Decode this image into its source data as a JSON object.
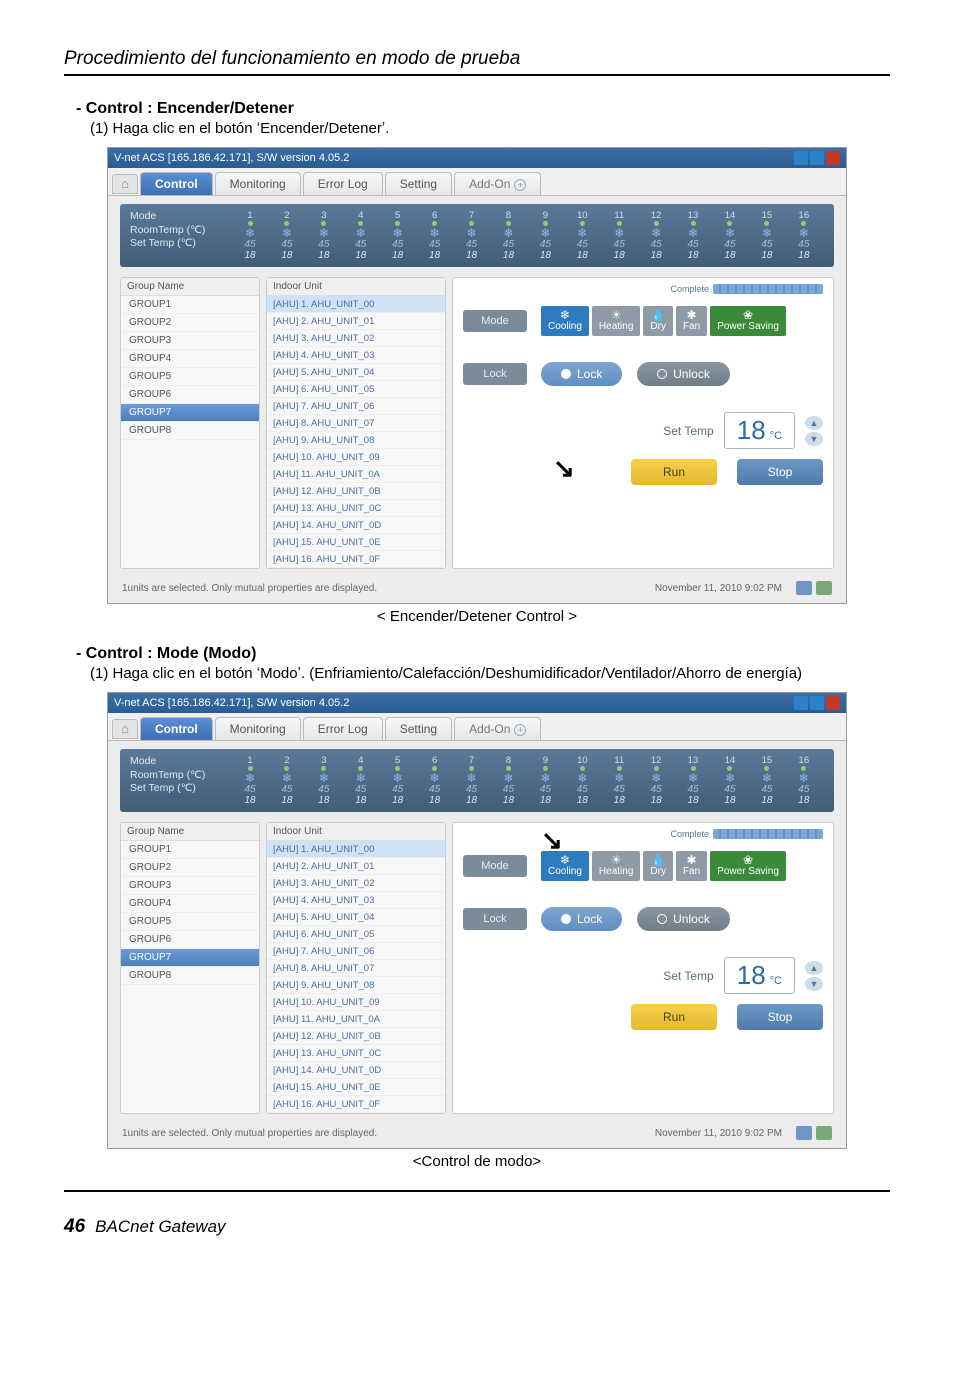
{
  "page": {
    "header_title": "Procedimiento del funcionamiento en modo de prueba",
    "footer_num": "46",
    "footer_title": "BACnet Gateway"
  },
  "section1": {
    "heading": "- Control : Encender/Detener",
    "sub": "(1) Haga clic en el botón ʻEncender/Detenerʼ.",
    "caption": "< Encender/Detener Control >"
  },
  "section2": {
    "heading": "- Control : Mode (Modo)",
    "sub": "(1) Haga clic en el botón ʻModoʼ. (Enfriamiento/Calefacción/Deshumidificador/Ventilador/Ahorro de energía)",
    "caption": "<Control de modo>"
  },
  "app": {
    "window_title": "V-net ACS [165.186.42.171], S/W version 4.05.2",
    "tabs": {
      "home": "⌂",
      "control": "Control",
      "monitoring": "Monitoring",
      "errorlog": "Error Log",
      "setting": "Setting",
      "addon": "Add-On"
    },
    "top_labels": {
      "mode": "Mode",
      "roomtemp": "RoomTemp (℃)",
      "settemp": "Set Temp  (℃)"
    },
    "top_cols": [
      "1",
      "2",
      "3",
      "4",
      "5",
      "6",
      "7",
      "8",
      "9",
      "10",
      "11",
      "12",
      "13",
      "14",
      "15",
      "16"
    ],
    "top_rt": "45",
    "top_st": "18",
    "panels": {
      "group_head": "Group Name",
      "unit_head": "Indoor Unit"
    },
    "groups": [
      "GROUP1",
      "GROUP2",
      "GROUP3",
      "GROUP4",
      "GROUP5",
      "GROUP6",
      "GROUP7",
      "GROUP8"
    ],
    "units": [
      "[AHU] 1. AHU_UNIT_00",
      "[AHU] 2. AHU_UNIT_01",
      "[AHU] 3. AHU_UNIT_02",
      "[AHU] 4. AHU_UNIT_03",
      "[AHU] 5. AHU_UNIT_04",
      "[AHU] 6. AHU_UNIT_05",
      "[AHU] 7. AHU_UNIT_06",
      "[AHU] 8. AHU_UNIT_07",
      "[AHU] 9. AHU_UNIT_08",
      "[AHU] 10. AHU_UNIT_09",
      "[AHU] 11. AHU_UNIT_0A",
      "[AHU] 12. AHU_UNIT_0B",
      "[AHU] 13. AHU_UNIT_0C",
      "[AHU] 14. AHU_UNIT_0D",
      "[AHU] 15. AHU_UNIT_0E",
      "[AHU] 16. AHU_UNIT_0F"
    ],
    "ctrl": {
      "complete": "Complete",
      "mode_label": "Mode",
      "lock_label": "Lock",
      "modes": {
        "cooling": "Cooling",
        "heating": "Heating",
        "dry": "Dry",
        "fan": "Fan",
        "saving": "Power Saving"
      },
      "lock": "Lock",
      "unlock": "Unlock",
      "settemp": "Set Temp",
      "temp_val": "18",
      "temp_unit": "°C",
      "run": "Run",
      "stop": "Stop"
    },
    "footer": {
      "status": "1units are selected. Only mutual properties are displayed.",
      "datetime": "November 11, 2010  9:02 PM"
    }
  }
}
